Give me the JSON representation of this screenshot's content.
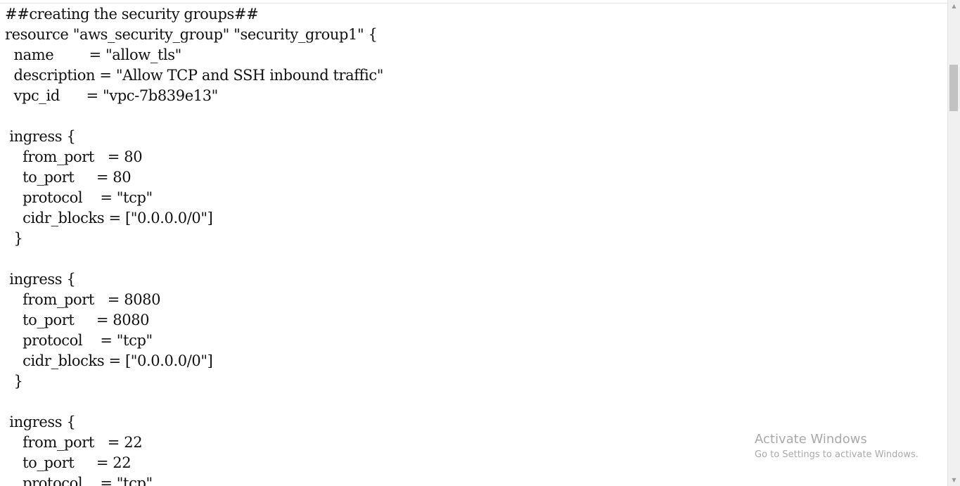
{
  "editor": {
    "lines": [
      "##creating the security groups##",
      "resource \"aws_security_group\" \"security_group1\" {",
      "  name        = \"allow_tls\"",
      "  description = \"Allow TCP and SSH inbound traffic\"",
      "  vpc_id      = \"vpc-7b839e13\"",
      "",
      " ingress {",
      "    from_port   = 80",
      "    to_port     = 80",
      "    protocol    = \"tcp\"",
      "    cidr_blocks = [\"0.0.0.0/0\"]",
      "  }",
      "",
      " ingress {",
      "    from_port   = 8080",
      "    to_port     = 8080",
      "    protocol    = \"tcp\"",
      "    cidr_blocks = [\"0.0.0.0/0\"]",
      "  }",
      "",
      " ingress {",
      "    from_port   = 22",
      "    to_port     = 22",
      "    protocol    = \"tcp\""
    ]
  },
  "scrollbar": {
    "up_icon": "scroll-up-arrow",
    "down_icon": "scroll-down-arrow"
  },
  "watermark": {
    "title": "Activate Windows",
    "subtitle": "Go to Settings to activate Windows."
  }
}
